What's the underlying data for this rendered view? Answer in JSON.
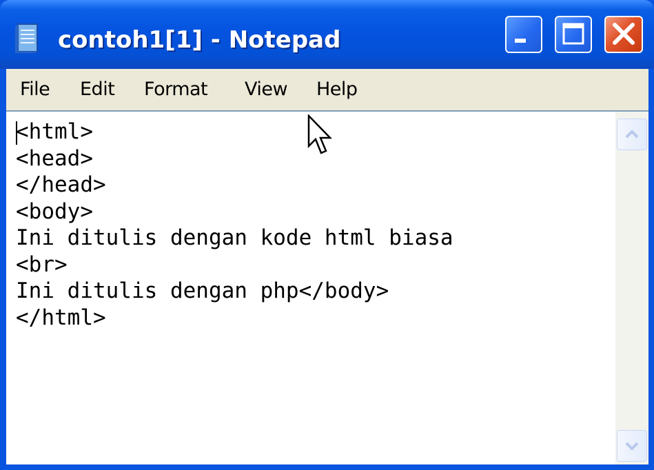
{
  "window": {
    "title": "contoh1[1] - Notepad",
    "app_icon": "notepad-icon",
    "controls": {
      "minimize": "minimize-icon",
      "maximize": "maximize-icon",
      "close": "close-icon"
    }
  },
  "menubar": {
    "items": [
      {
        "label": "File"
      },
      {
        "label": "Edit"
      },
      {
        "label": "Format"
      },
      {
        "label": "View"
      },
      {
        "label": "Help"
      }
    ]
  },
  "editor": {
    "content": "<html>\n<head>\n</head>\n<body>\nIni ditulis dengan kode html biasa\n<br>\nIni ditulis dengan php</body>\n</html>"
  },
  "scrollbar": {
    "up": "scroll-up-arrow-icon",
    "down": "scroll-down-arrow-icon"
  },
  "colors": {
    "titlebar": "#0553e0",
    "menubar": "#ece9d8",
    "close_button": "#e0522a"
  }
}
